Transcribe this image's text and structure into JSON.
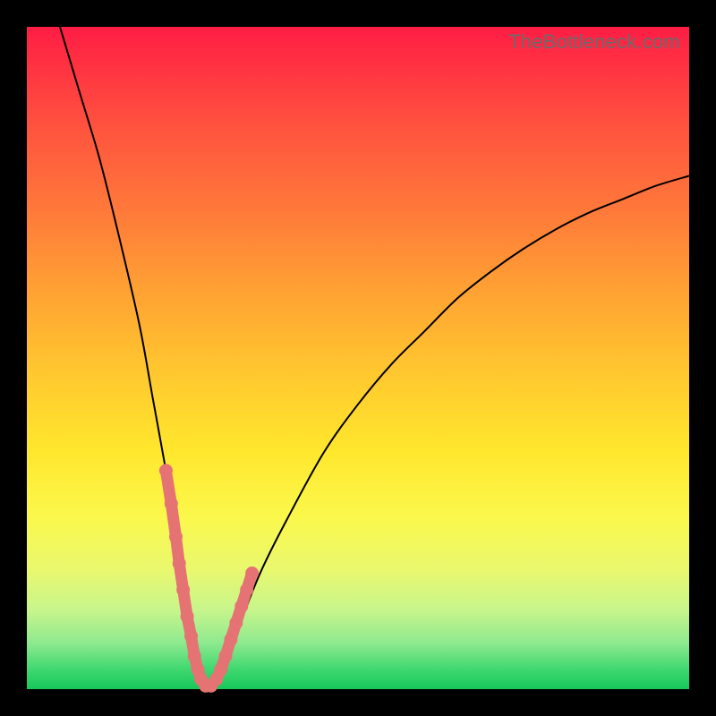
{
  "watermark": "TheBottleneck.com",
  "colors": {
    "gradient_top": "#ff1d44",
    "gradient_bottom": "#17c85a",
    "curve": "#000000",
    "marker": "#e57373",
    "frame": "#000000"
  },
  "chart_data": {
    "type": "line",
    "title": "",
    "xlabel": "",
    "ylabel": "",
    "x_range": [
      0,
      100
    ],
    "y_range": [
      0,
      100
    ],
    "series": [
      {
        "name": "bottleneck-curve",
        "x": [
          5,
          8,
          11,
          14,
          17,
          19,
          21,
          23,
          24.5,
          26,
          27,
          28,
          29,
          30,
          35,
          40,
          45,
          50,
          55,
          60,
          65,
          70,
          75,
          80,
          85,
          90,
          95,
          100
        ],
        "y": [
          100,
          90,
          80,
          68,
          55,
          44,
          33,
          21,
          11,
          2,
          0,
          0,
          1,
          4,
          17,
          27,
          36,
          43,
          49,
          54,
          59,
          63,
          66.5,
          69.5,
          72,
          74,
          76,
          77.5
        ]
      }
    ],
    "highlight_points": {
      "name": "bottleneck-zone",
      "comment": "Salmon markers clustered around the minimum of the curve, roughly x∈[21,34], y≤~35",
      "points": [
        {
          "x": 21.0,
          "y": 33
        },
        {
          "x": 21.8,
          "y": 28
        },
        {
          "x": 22.5,
          "y": 23
        },
        {
          "x": 23.0,
          "y": 19
        },
        {
          "x": 23.6,
          "y": 15
        },
        {
          "x": 24.2,
          "y": 11
        },
        {
          "x": 24.8,
          "y": 8
        },
        {
          "x": 25.3,
          "y": 5
        },
        {
          "x": 25.8,
          "y": 3
        },
        {
          "x": 26.3,
          "y": 1.5
        },
        {
          "x": 27.0,
          "y": 0.5
        },
        {
          "x": 27.8,
          "y": 0.5
        },
        {
          "x": 28.6,
          "y": 1.5
        },
        {
          "x": 29.3,
          "y": 3
        },
        {
          "x": 30.0,
          "y": 5
        },
        {
          "x": 30.8,
          "y": 7.5
        },
        {
          "x": 31.6,
          "y": 10
        },
        {
          "x": 32.4,
          "y": 12.5
        },
        {
          "x": 33.2,
          "y": 15
        },
        {
          "x": 34.0,
          "y": 17.5
        }
      ]
    }
  }
}
